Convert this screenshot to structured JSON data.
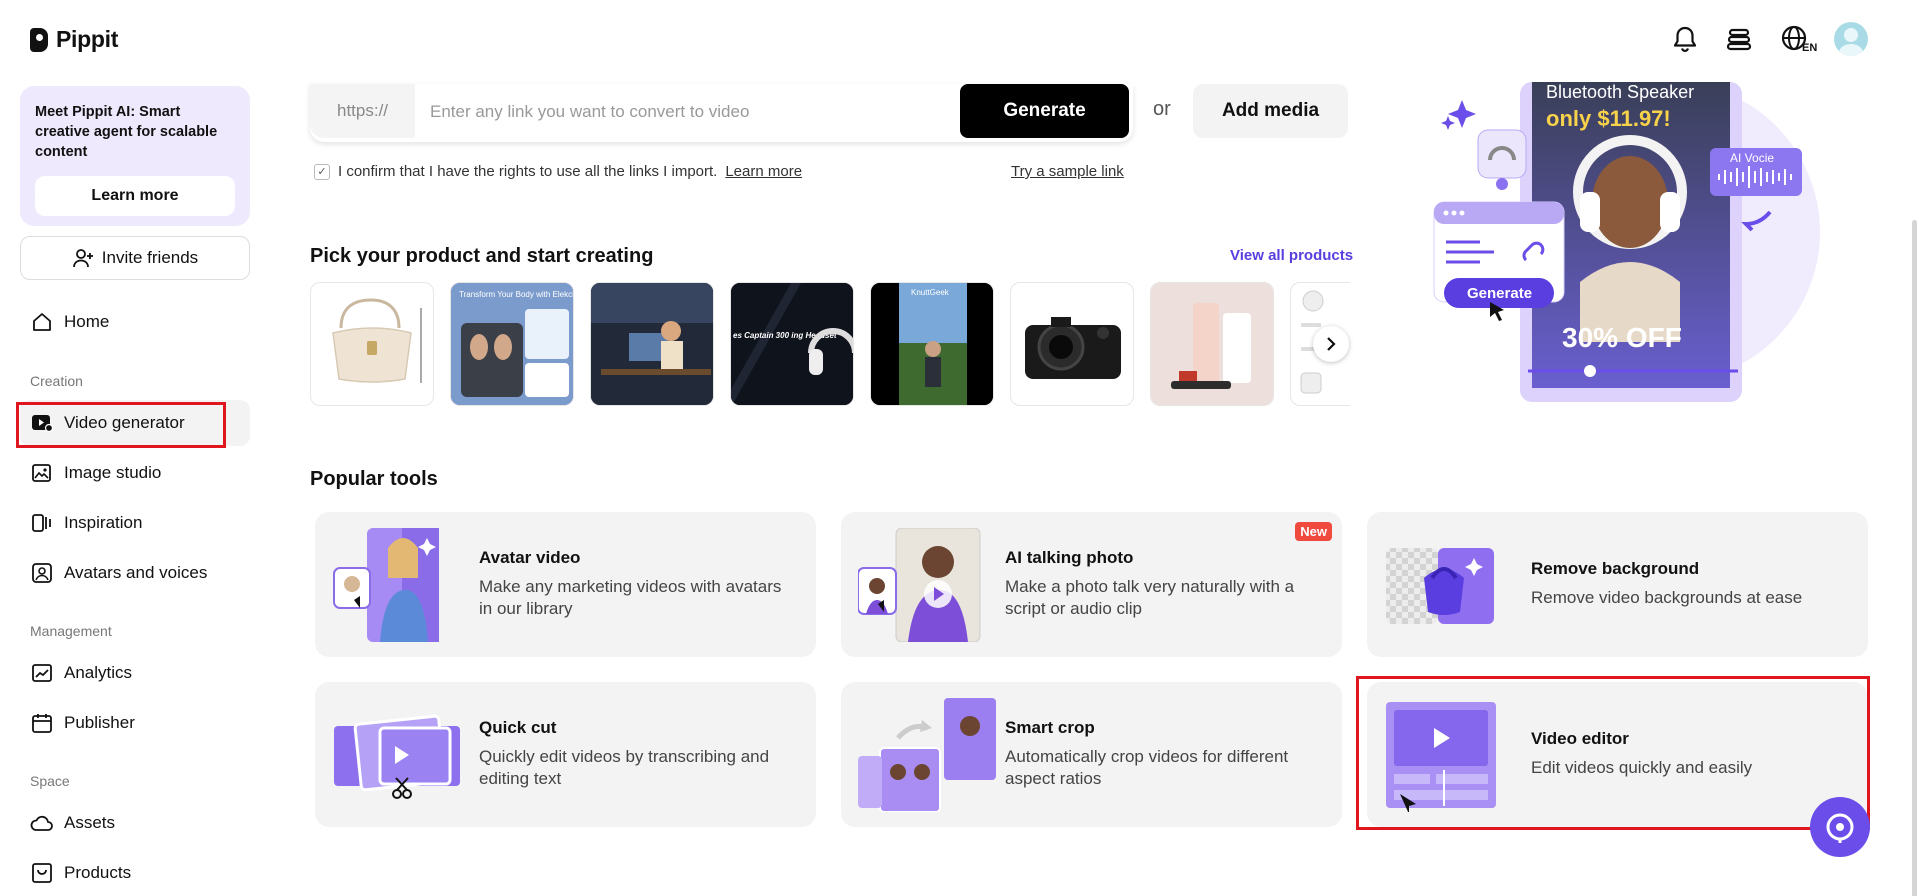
{
  "app": {
    "name": "Pippit"
  },
  "header": {
    "lang": "EN"
  },
  "sidebar": {
    "promo_text": "Meet Pippit AI: Smart creative agent for scalable content",
    "promo_button": "Learn more",
    "invite": "Invite friends",
    "home": "Home",
    "sections": {
      "creation": "Creation",
      "management": "Management",
      "space": "Space"
    },
    "items": {
      "video_generator": "Video generator",
      "image_studio": "Image studio",
      "inspiration": "Inspiration",
      "avatars_voices": "Avatars and voices",
      "analytics": "Analytics",
      "publisher": "Publisher",
      "assets": "Assets",
      "products": "Products"
    }
  },
  "link": {
    "prefix": "https://",
    "placeholder": "Enter any link you want to convert to video",
    "generate": "Generate",
    "or": "or",
    "add_media": "Add media",
    "confirm_text": "I confirm that I have the rights to use all the links I import.",
    "learn_more": "Learn more",
    "sample": "Try a sample link"
  },
  "products": {
    "title": "Pick your product and start creating",
    "view_all": "View all products",
    "thumb_texts": {
      "scale": "Transform Your Body with Elekcity",
      "headset": "es Captain 300 ing Headset",
      "knuttgeek": "KnuttGeek"
    }
  },
  "banner": {
    "headline": "Bluetooth Speaker",
    "price": "only $11.97!",
    "discount": "30% OFF",
    "voice_label": "AI Vocie",
    "generate": "Generate"
  },
  "tools": {
    "title": "Popular tools",
    "items": [
      {
        "title": "Avatar video",
        "desc": "Make any marketing videos with avatars in our library"
      },
      {
        "title": "AI talking photo",
        "desc": "Make a photo talk very naturally with a script or audio clip",
        "badge": "New"
      },
      {
        "title": "Remove background",
        "desc": "Remove video backgrounds at ease"
      },
      {
        "title": "Quick cut",
        "desc": "Quickly edit videos by transcribing and editing text"
      },
      {
        "title": "Smart crop",
        "desc": "Automatically crop videos for different aspect ratios"
      },
      {
        "title": "Video editor",
        "desc": "Edit videos quickly and easily"
      }
    ]
  },
  "colors": {
    "accent": "#6b4dea",
    "highlight": "#e0161e"
  }
}
